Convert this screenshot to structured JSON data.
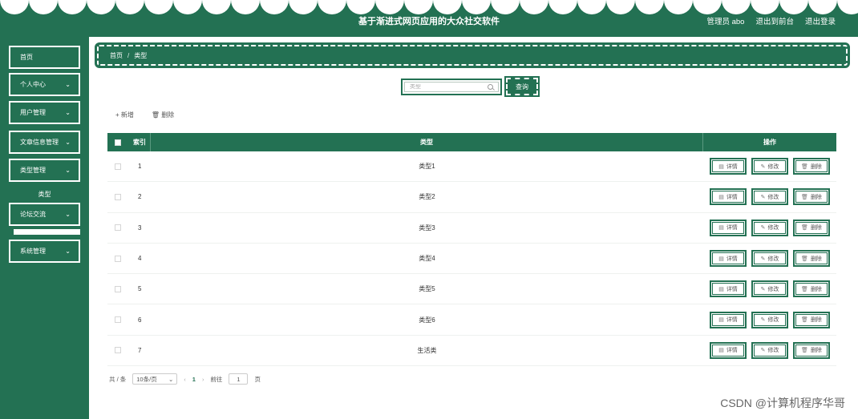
{
  "header": {
    "title": "基于渐进式网页应用的大众社交软件",
    "admin_label": "管理员 abo",
    "backend_link": "退出到前台",
    "logout_link": "退出登录"
  },
  "sidebar": {
    "items": [
      {
        "label": "首页",
        "has_chevron": false
      },
      {
        "label": "个人中心",
        "has_chevron": true
      },
      {
        "label": "用户管理",
        "has_chevron": true
      },
      {
        "label": "文章信息管理",
        "has_chevron": true
      },
      {
        "label": "类型管理",
        "has_chevron": true
      },
      {
        "label": "论坛交流",
        "has_chevron": true
      },
      {
        "label": "系统管理",
        "has_chevron": true
      }
    ],
    "submenu_label": "类型"
  },
  "breadcrumb": {
    "home": "首页",
    "separator": "/",
    "current": "类型"
  },
  "search": {
    "placeholder": "类型",
    "button_label": "查询"
  },
  "actions": {
    "add_label": "+ 新增",
    "delete_label": "删除"
  },
  "table": {
    "headers": {
      "index": "索引",
      "type": "类型",
      "ops": "操作"
    },
    "rows": [
      {
        "index": "1",
        "type": "类型1"
      },
      {
        "index": "2",
        "type": "类型2"
      },
      {
        "index": "3",
        "type": "类型3"
      },
      {
        "index": "4",
        "type": "类型4"
      },
      {
        "index": "5",
        "type": "类型5"
      },
      {
        "index": "6",
        "type": "类型6"
      },
      {
        "index": "7",
        "type": "生活类"
      }
    ],
    "op_labels": {
      "detail": "详情",
      "edit": "修改",
      "delete": "删除"
    }
  },
  "pagination": {
    "total_label": "共 / 条",
    "page_size": "10条/页",
    "current_page": "1",
    "goto_prefix": "前往",
    "goto_value": "1",
    "goto_suffix": "页"
  },
  "watermark": "CSDN @计算机程序华哥",
  "colors": {
    "primary": "#237153",
    "background": "#ffffff"
  }
}
